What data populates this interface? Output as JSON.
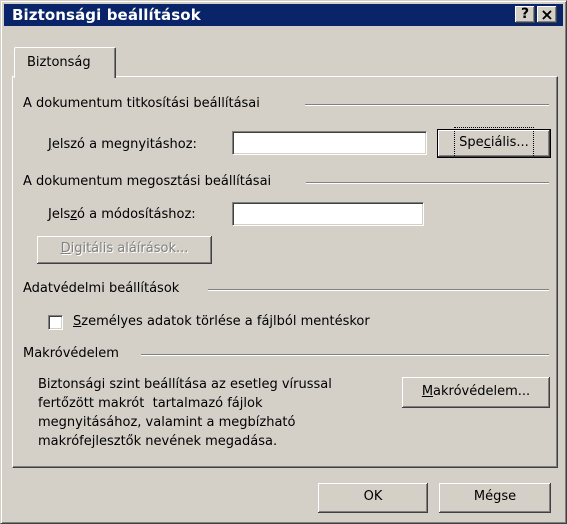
{
  "window": {
    "title": "Biztonsági beállítások",
    "help_glyph": "?",
    "close_glyph": "×"
  },
  "tabs": [
    {
      "label": "Biztonság",
      "selected": true
    }
  ],
  "encryption": {
    "title": "A dokumentum titkosítási beállításai",
    "password_label_u": "J",
    "password_label_rest": "elszó a megnyitáshoz:",
    "password_value": "",
    "advanced_pre": "Spe",
    "advanced_u": "c",
    "advanced_post": "iális..."
  },
  "sharing": {
    "title": "A dokumentum megosztási beállításai",
    "password_label_pre": "Jels",
    "password_label_u": "z",
    "password_label_post": "ó a módosításhoz:",
    "password_value": "",
    "signatures_u": "D",
    "signatures_rest": "igitális aláírások...",
    "signatures_enabled": false
  },
  "privacy": {
    "title": "Adatvédelmi beállítások",
    "remove_info_u": "S",
    "remove_info_rest": "zemélyes adatok törlése a fájlból mentéskor",
    "remove_info_checked": false
  },
  "macro": {
    "title": "Makróvédelem",
    "description_lines": [
      "Biztonsági szint beállítása az esetleg vírussal",
      "fertőzött makrót  tartalmazó fájlok",
      "megnyitásához, valamint a megbízható",
      "makrófejlesztők nevének megadása."
    ],
    "button_u": "M",
    "button_rest": "akróvédelem..."
  },
  "footer": {
    "ok_label": "OK",
    "cancel_label": "Mégse"
  }
}
